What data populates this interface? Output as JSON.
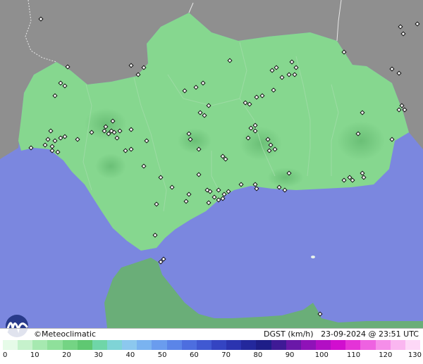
{
  "map": {
    "title": "DGST (km/h)",
    "timestamp": "23-09-2024 @ 23:51 UTC",
    "brand": "©Meteoclimatic",
    "colors": {
      "sea": "#7b87df",
      "land_out": "#8f8f8f",
      "region": "#86d78f",
      "region_dark": "#6fc07d",
      "africa": "#6aae78",
      "station": "#111111"
    }
  },
  "legend": {
    "unit": "km/h",
    "ticks": [
      "0",
      "10",
      "20",
      "30",
      "40",
      "50",
      "60",
      "70",
      "80",
      "90",
      "100",
      "110",
      "120",
      "130"
    ],
    "colors": [
      "#e6fbe8",
      "#c6f2cc",
      "#a6e9b0",
      "#8fe09b",
      "#74d484",
      "#5fc872",
      "#6fd6a8",
      "#7fd4d6",
      "#8cc8ee",
      "#7ab3f0",
      "#6a9cee",
      "#5b85e8",
      "#4d6edf",
      "#4059d2",
      "#3444c2",
      "#2b34b0",
      "#23289c",
      "#1e1e88",
      "#3f1a96",
      "#6a18a8",
      "#8f12b8",
      "#b20fc4",
      "#d10ecf",
      "#e433d7",
      "#ee62e1",
      "#f58ee9",
      "#fab6f0",
      "#fdd8f7"
    ]
  }
}
